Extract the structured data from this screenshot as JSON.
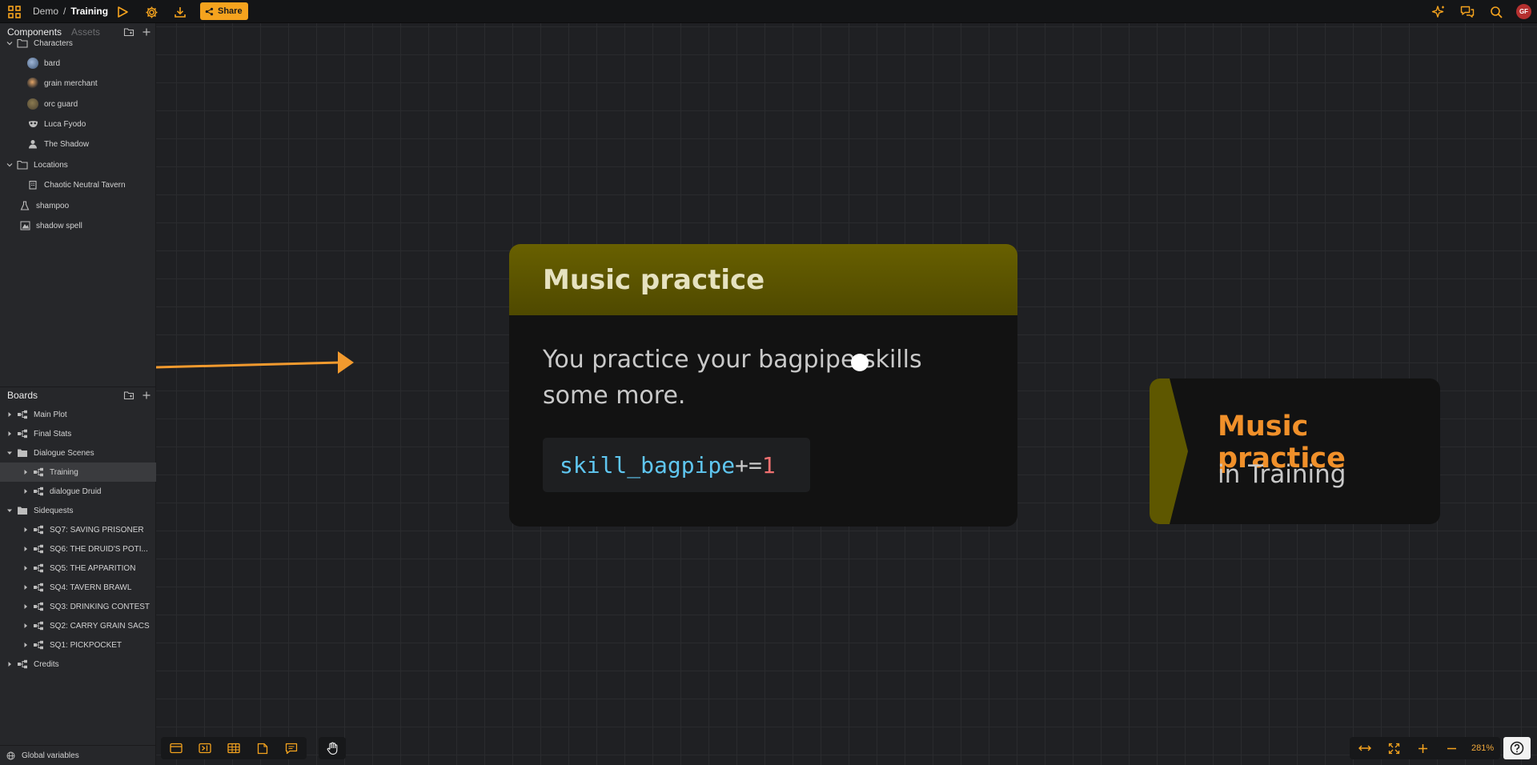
{
  "topbar": {
    "breadcrumb": [
      "Demo",
      "Training"
    ],
    "separator": "/",
    "share_label": "Share",
    "avatar_initials": "GF",
    "accent": "#f5a31e"
  },
  "components": {
    "tab_active": "Components",
    "tab_inactive": "Assets",
    "items": [
      {
        "label": "Characters",
        "kind": "folder"
      },
      {
        "label": "bard",
        "kind": "character"
      },
      {
        "label": "grain merchant",
        "kind": "character"
      },
      {
        "label": "orc guard",
        "kind": "character"
      },
      {
        "label": "Luca Fyodo",
        "kind": "character"
      },
      {
        "label": "The Shadow",
        "kind": "character"
      },
      {
        "label": "Locations",
        "kind": "folder"
      },
      {
        "label": "Chaotic Neutral Tavern",
        "kind": "location"
      },
      {
        "label": "shampoo",
        "kind": "item"
      },
      {
        "label": "shadow spell",
        "kind": "item"
      }
    ]
  },
  "boards": {
    "title": "Boards",
    "items": [
      {
        "label": "Main Plot",
        "kind": "board"
      },
      {
        "label": "Final Stats",
        "kind": "board"
      },
      {
        "label": "Dialogue Scenes",
        "kind": "folder"
      },
      {
        "label": "Training",
        "kind": "board",
        "selected": true
      },
      {
        "label": "dialogue Druid",
        "kind": "board"
      },
      {
        "label": "Sidequests",
        "kind": "folder"
      },
      {
        "label": "SQ7: SAVING PRISONER",
        "kind": "board"
      },
      {
        "label": "SQ6: THE DRUID'S POTI...",
        "kind": "board"
      },
      {
        "label": "SQ5: THE APPARITION",
        "kind": "board"
      },
      {
        "label": "SQ4: TAVERN BRAWL",
        "kind": "board"
      },
      {
        "label": "SQ3: DRINKING CONTEST",
        "kind": "board"
      },
      {
        "label": "SQ2: CARRY GRAIN SACS",
        "kind": "board"
      },
      {
        "label": "SQ1: PICKPOCKET",
        "kind": "board"
      },
      {
        "label": "Credits",
        "kind": "board"
      }
    ],
    "global_variables_label": "Global variables"
  },
  "node": {
    "title": "Music practice",
    "text": "You practice your bagpipe skills some more.",
    "code": {
      "variable": "skill_bagpipe",
      "operator": "+=",
      "value": "1"
    },
    "header_color": "#5e5700"
  },
  "target": {
    "title": "Music practice",
    "subtitle": "in Training"
  },
  "bottom": {
    "zoom_label": "281%"
  }
}
